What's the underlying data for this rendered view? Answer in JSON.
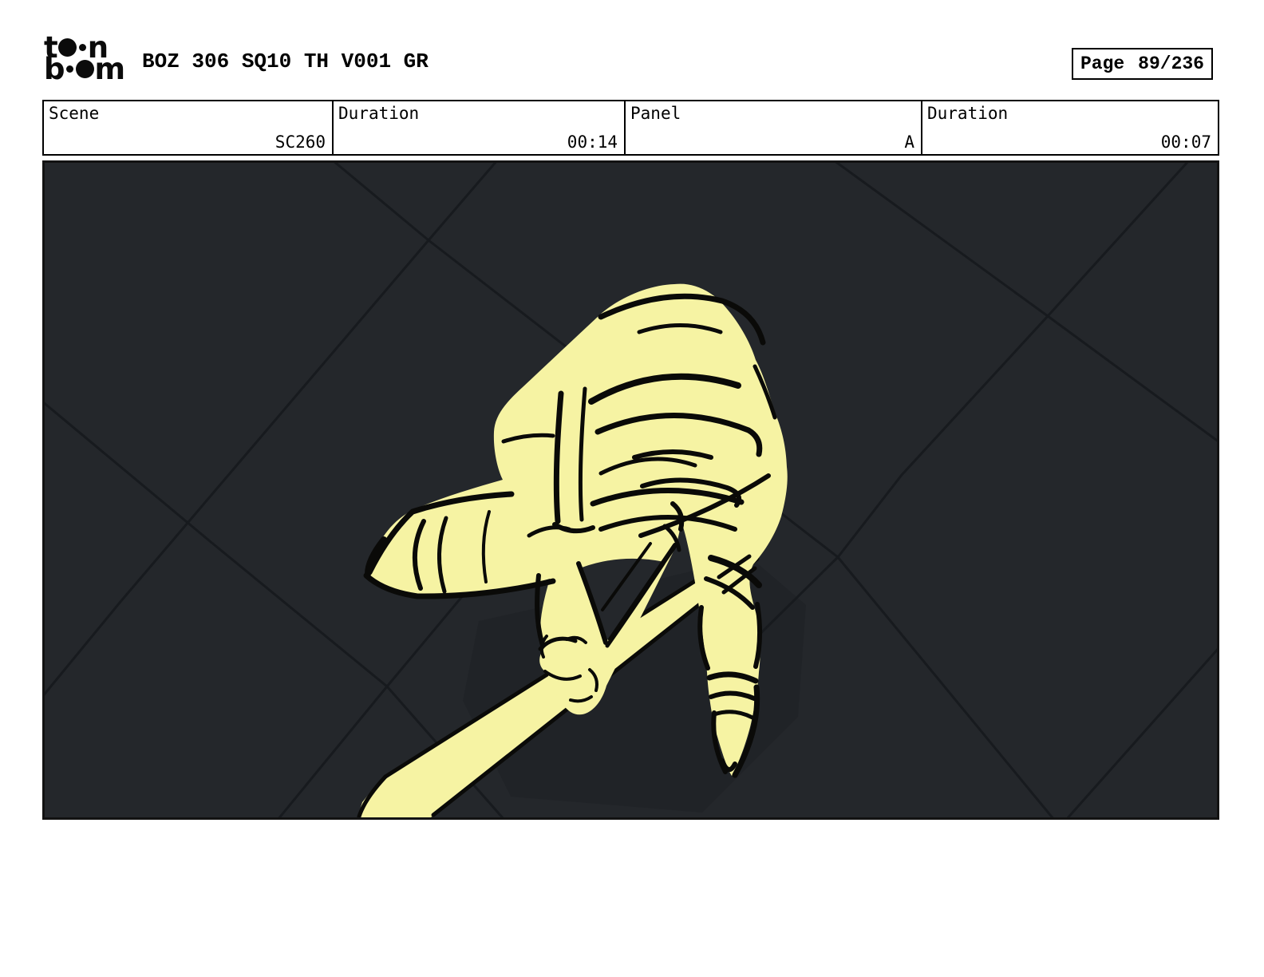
{
  "header": {
    "logo": {
      "chars": [
        "t",
        "n",
        "b",
        "m"
      ],
      "alt_line1": "toon",
      "alt_line2": "boom"
    },
    "title": "BOZ 306 SQ10 TH V001 GR",
    "page": {
      "label": "Page",
      "value": "89/236"
    }
  },
  "info_table": {
    "cells": [
      {
        "label": "Scene",
        "value": "SC260"
      },
      {
        "label": "Duration",
        "value": "00:14"
      },
      {
        "label": "Panel",
        "value": "A"
      },
      {
        "label": "Duration",
        "value": "00:07"
      }
    ]
  },
  "panel": {
    "colors": {
      "bg": "#24272b",
      "line": "#171a1e",
      "shadow": "#202327",
      "figure": "#f6f3a3",
      "ink": "#0a0a08",
      "border": "#121212"
    }
  }
}
